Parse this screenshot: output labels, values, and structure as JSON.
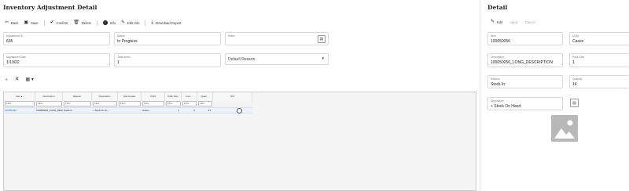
{
  "left": {
    "title": "Inventory Adjustment Detail",
    "toolbar": {
      "back": "Back",
      "save": "Save",
      "confirm": "Confirm",
      "delete": "Delete",
      "info": "Info",
      "edit_info": "Edit Info",
      "download_report": "Download Report"
    },
    "fields": {
      "adjustment_id": {
        "label": "Adjustment ID",
        "value": "635"
      },
      "status": {
        "label": "Status",
        "value": "In Progress"
      },
      "notes": {
        "label": "Notes",
        "value": ""
      },
      "adjustment_date": {
        "label": "Adjustment Date",
        "value": "1/19/22"
      },
      "total_items": {
        "label": "Total Items",
        "value": "1"
      },
      "default_reason": {
        "label": "",
        "value": "Default Reason"
      }
    },
    "grid": {
      "columns": [
        "Item",
        "Description",
        "Reason",
        "Disposition",
        "Sub-bucket",
        "UOM",
        "Pack Size",
        "Inve...",
        "Quan...",
        "SIN"
      ],
      "filter_placeholder": "Filter",
      "rows": [
        [
          "100050056",
          "100050056_LONG_DESCRIPTION",
          "Stock In",
          "+ Stock On H...",
          "",
          "Cases",
          "1",
          "0",
          "14",
          ""
        ]
      ]
    }
  },
  "right": {
    "title": "Detail",
    "toolbar": {
      "edit": "Edit",
      "apply": "Apply",
      "cancel": "Cancel"
    },
    "fields": {
      "item": {
        "label": "Item",
        "value": "100050056"
      },
      "uom": {
        "label": "UOM",
        "value": "Cases"
      },
      "description": {
        "label": "Description",
        "value": "100050056_LONG_DESCRIPTION"
      },
      "pack_size": {
        "label": "Pack Size",
        "value": "1"
      },
      "reason": {
        "label": "Reason",
        "value": "Stock In"
      },
      "quantity": {
        "label": "Quantity",
        "value": "14"
      },
      "disposition": {
        "label": "Disposition",
        "value": "+ Stock On Hand"
      }
    }
  },
  "icons": {
    "back": "arrow-left-icon",
    "save": "save-icon",
    "confirm": "check-circle-icon",
    "delete": "trash-icon",
    "info": "info-icon",
    "edit_info": "pencil-icon",
    "download_report": "download-icon",
    "add": "plus-icon",
    "remove": "close-icon",
    "columns": "view-menu-icon",
    "image_placeholder": "image-placeholder-icon"
  },
  "colors": {
    "selected_row": "#eaf2fb",
    "border": "#d9d9d9",
    "image_placeholder": "#b8b8b8"
  }
}
